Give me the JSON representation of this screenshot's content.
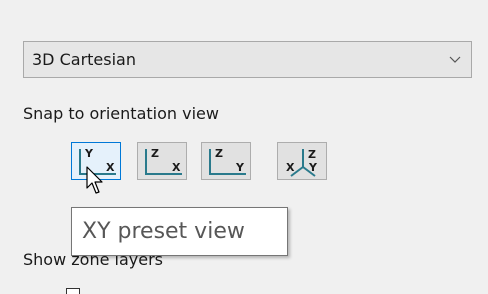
{
  "coordinate_system": {
    "selected": "3D Cartesian",
    "chevron_icon": "chevron-down-icon"
  },
  "snap": {
    "label": "Snap to orientation view",
    "buttons": [
      {
        "name": "xy",
        "icon": "xy-view-icon",
        "axis_top": "Y",
        "axis_right": "X",
        "active": true
      },
      {
        "name": "zx",
        "icon": "zx-view-icon",
        "axis_top": "Z",
        "axis_right": "X",
        "active": false
      },
      {
        "name": "zy",
        "icon": "zy-view-icon",
        "axis_top": "Z",
        "axis_right": "Y",
        "active": false
      },
      {
        "name": "iso",
        "icon": "isometric-view-icon",
        "axis_top": "Z",
        "axis_left": "X",
        "axis_right": "Y",
        "active": false
      }
    ]
  },
  "tooltip": {
    "text": "XY preset view"
  },
  "zone_layers": {
    "label": "Show zone layers"
  },
  "colors": {
    "accent": "#0078d7",
    "active_button_bg": "#e5f1fb",
    "axis_line": "#2a7a8c"
  }
}
